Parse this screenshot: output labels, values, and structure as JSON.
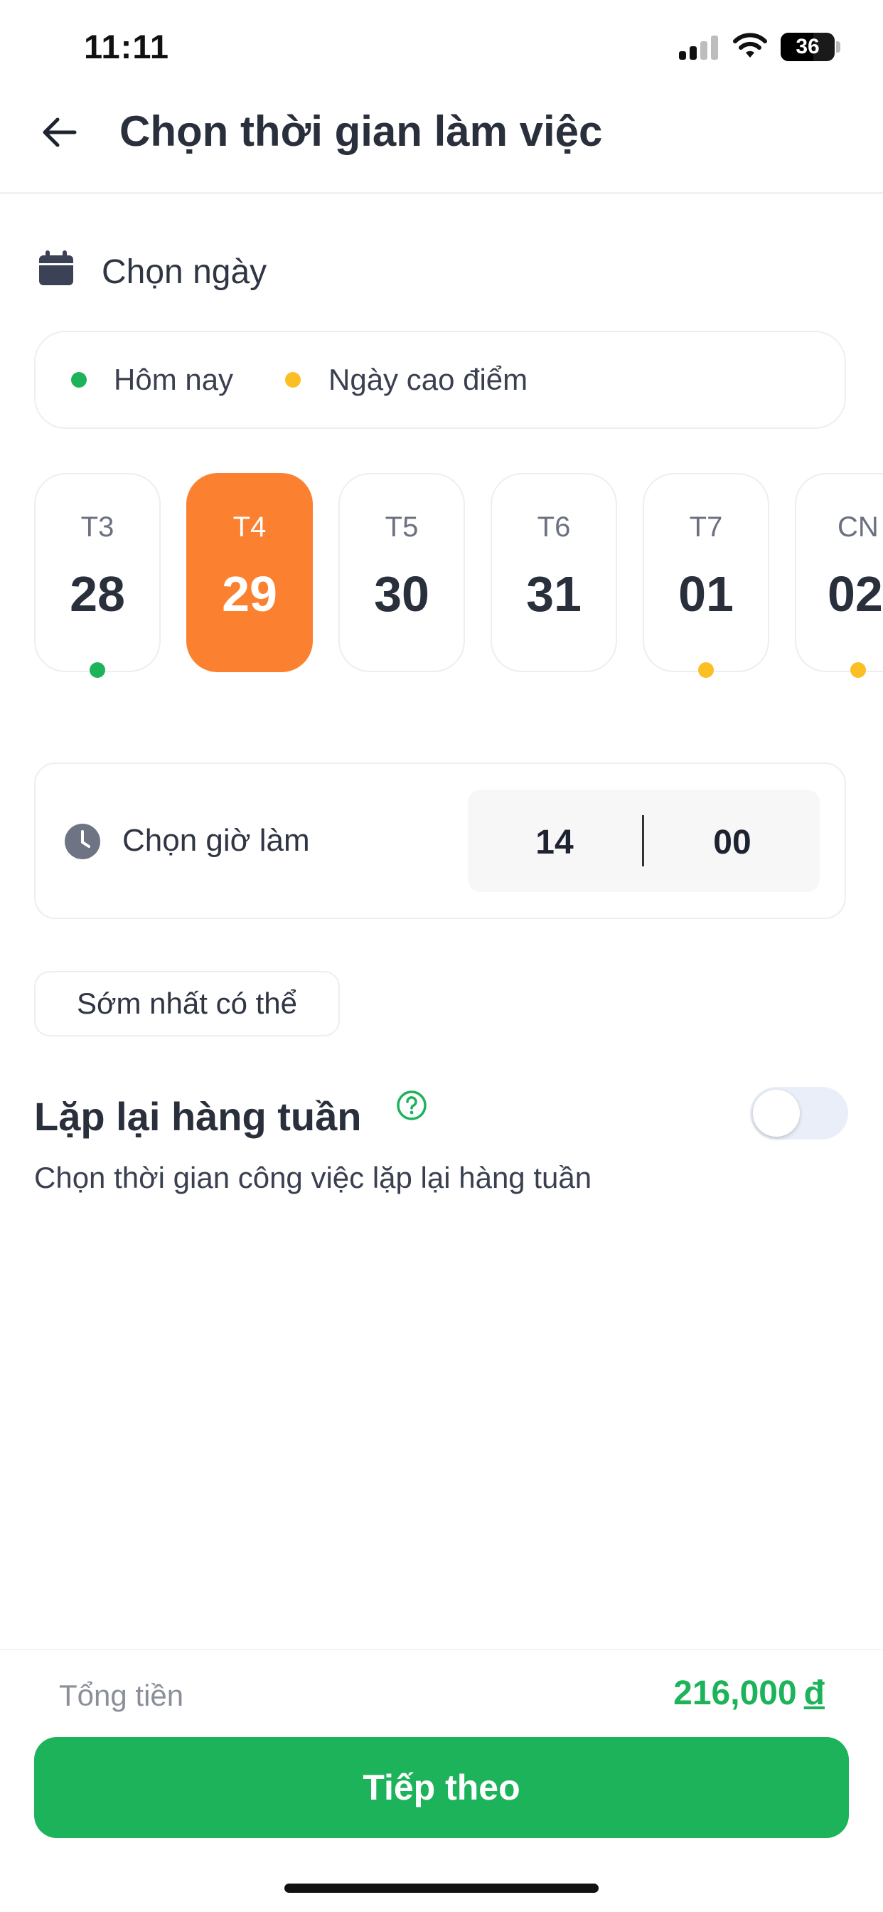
{
  "status_bar": {
    "time": "11:11",
    "battery": "36"
  },
  "header": {
    "title": "Chọn thời gian làm việc"
  },
  "date_section": {
    "label": "Chọn ngày",
    "legend": [
      {
        "label": "Hôm nay",
        "color": "#1db35a"
      },
      {
        "label": "Ngày cao điểm",
        "color": "#fbbf24"
      }
    ],
    "days": [
      {
        "weekday": "T3",
        "day": "28",
        "marker": "today"
      },
      {
        "weekday": "T4",
        "day": "29",
        "selected": true
      },
      {
        "weekday": "T5",
        "day": "30"
      },
      {
        "weekday": "T6",
        "day": "31"
      },
      {
        "weekday": "T7",
        "day": "01",
        "marker": "peak"
      },
      {
        "weekday": "CN",
        "day": "02",
        "marker": "peak"
      }
    ]
  },
  "time_section": {
    "label": "Chọn giờ làm",
    "hour": "14",
    "minute": "00"
  },
  "asap_label": "Sớm nhất có thể",
  "weekly_repeat": {
    "title": "Lặp lại hàng tuần",
    "description": "Chọn thời gian công việc lặp lại hàng tuần",
    "enabled": false
  },
  "footer": {
    "total_label": "Tổng tiền",
    "total_amount": "216,000",
    "currency": "đ",
    "next_button": "Tiếp theo"
  },
  "colors": {
    "accent_green": "#1db35a",
    "selected_orange": "#fb8130",
    "peak_yellow": "#fbbf24"
  }
}
